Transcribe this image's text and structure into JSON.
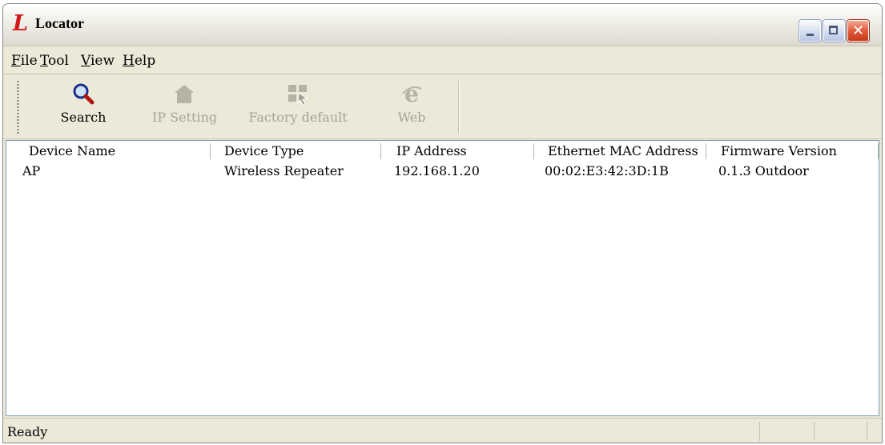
{
  "window": {
    "title": "Locator",
    "logo_letter": "L",
    "close_glyph": "✕"
  },
  "menu": [
    {
      "label": "File",
      "mnemonic": "F",
      "rest": "ile"
    },
    {
      "label": "Tool",
      "mnemonic": "T",
      "rest": "ool"
    },
    {
      "label": "View",
      "mnemonic": "V",
      "rest": "iew"
    },
    {
      "label": "Help",
      "mnemonic": "H",
      "rest": "elp"
    }
  ],
  "toolbar": {
    "search": {
      "label": "Search",
      "icon": "search-icon",
      "enabled": true
    },
    "ip_setting": {
      "label": "IP Setting",
      "icon": "house-icon",
      "enabled": false
    },
    "factory_default": {
      "label": "Factory default",
      "icon": "factory-reset-icon",
      "enabled": false
    },
    "web": {
      "label": "Web",
      "icon": "internet-explorer-icon",
      "enabled": false
    }
  },
  "device_list": {
    "columns": [
      "Device Name",
      "Device Type",
      "IP Address",
      "Ethernet MAC Address",
      "Firmware Version"
    ],
    "rows": [
      [
        "AP",
        "Wireless Repeater",
        "192.168.1.20",
        "00:02:E3:42:3D:1B",
        "0.1.3 Outdoor"
      ]
    ]
  },
  "status": {
    "text": "Ready"
  },
  "colors": {
    "window_bg": "#ece9d8",
    "logo_red": "#d01818",
    "close_red": "#e05b3b",
    "disabled_text": "#a7a498"
  }
}
